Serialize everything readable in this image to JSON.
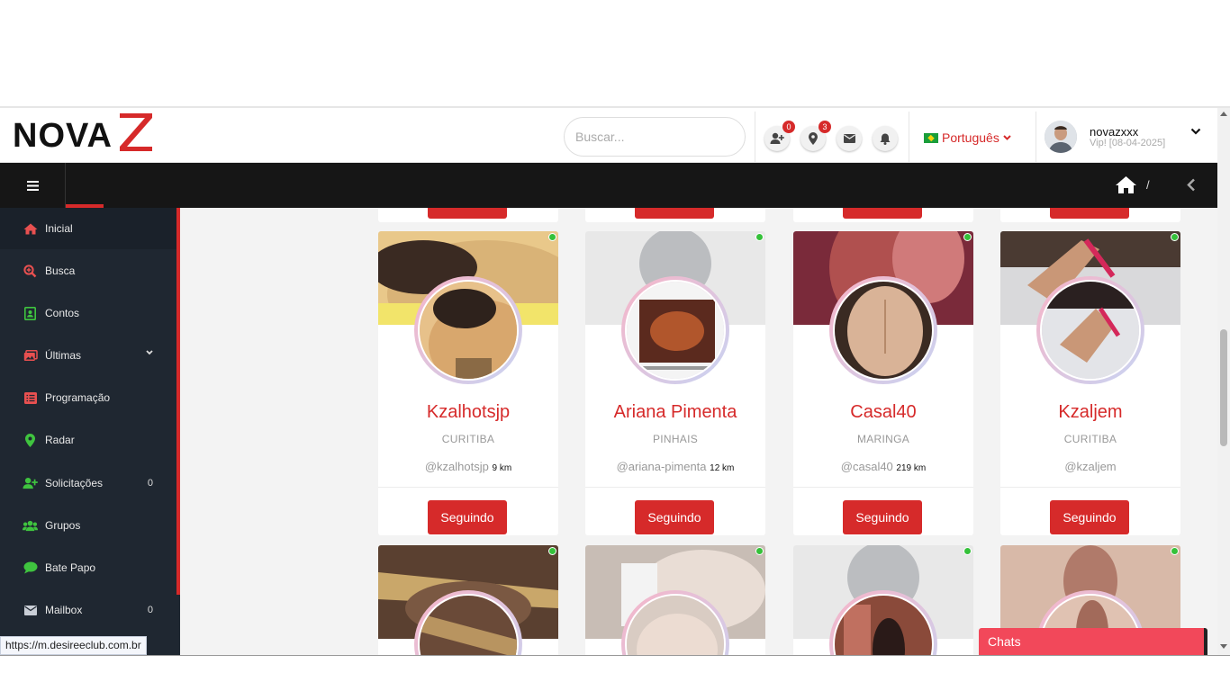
{
  "brand": {
    "logo_text": "NOVA",
    "logo_mark": "Z"
  },
  "header": {
    "search_placeholder": "Buscar...",
    "friend_requests_badge": "0",
    "location_badge": "3",
    "language": "Português",
    "user_name": "novazxxx",
    "user_status": "Vip! [08-04-2025]"
  },
  "topbar": {
    "breadcrumb_separator": "/"
  },
  "sidebar": {
    "items": [
      {
        "label": "Inicial",
        "icon": "home-icon"
      },
      {
        "label": "Busca",
        "icon": "search-plus-icon"
      },
      {
        "label": "Contos",
        "icon": "contact-book-icon"
      },
      {
        "label": "Últimas",
        "icon": "images-icon"
      },
      {
        "label": "Programação",
        "icon": "list-icon"
      },
      {
        "label": "Radar",
        "icon": "map-marker-icon"
      },
      {
        "label": "Solicitações",
        "icon": "user-plus-icon",
        "count": "0"
      },
      {
        "label": "Grupos",
        "icon": "users-icon"
      },
      {
        "label": "Bate Papo",
        "icon": "chat-icon"
      },
      {
        "label": "Mailbox",
        "icon": "envelope-icon",
        "count": "0"
      }
    ]
  },
  "profiles": [
    {
      "name": "Kzalhotsjp",
      "city": "CURITIBA",
      "handle": "@kzalhotsjp",
      "distance": "9 km",
      "button": "Seguindo"
    },
    {
      "name": "Ariana Pimenta",
      "city": "PINHAIS",
      "handle": "@ariana-pimenta",
      "distance": "12 km",
      "button": "Seguindo"
    },
    {
      "name": "Casal40",
      "city": "MARINGA",
      "handle": "@casal40",
      "distance": "219 km",
      "button": "Seguindo"
    },
    {
      "name": "Kzaljem",
      "city": "CURITIBA",
      "handle": "@kzaljem",
      "distance": "",
      "button": "Seguindo"
    }
  ],
  "chats_label": "Chats",
  "status_url": "https://m.desireeclub.com.br",
  "colors": {
    "accent": "#d62a2a",
    "sidebar": "#1f2731",
    "online": "#35c13a",
    "chats": "#f2485a"
  }
}
